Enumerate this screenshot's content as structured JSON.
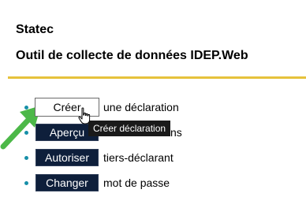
{
  "header": {
    "site_name": "Statec",
    "app_title": "Outil de collecte de données IDEP.Web"
  },
  "colors": {
    "accent_rule": "#e6c23c",
    "bullet": "#178fa8",
    "button_bg": "#0e1f3b",
    "annotation_arrow": "#4cb848"
  },
  "actions": [
    {
      "button_label": "Créer",
      "text": "une déclaration"
    },
    {
      "button_label": "Aperçu",
      "text": "ns"
    },
    {
      "button_label": "Autoriser",
      "text": "tiers-déclarant"
    },
    {
      "button_label": "Changer",
      "text": "mot de passe"
    }
  ],
  "tooltip": {
    "text": "Créer déclaration"
  },
  "icons": {
    "pointer": "hand-pointer-icon",
    "annotation": "green-arrow-icon"
  }
}
